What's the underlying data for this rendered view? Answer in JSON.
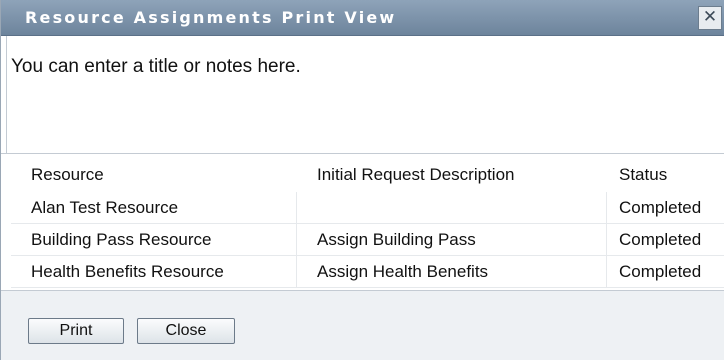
{
  "dialog": {
    "title": "Resource Assignments Print View",
    "close_glyph": "✕",
    "notes_text": "You can enter a title or notes here."
  },
  "table": {
    "columns": [
      "Resource",
      "Initial Request Description",
      "Status"
    ],
    "rows": [
      [
        "Alan Test Resource",
        "",
        "Completed"
      ],
      [
        "Building Pass Resource",
        "Assign Building Pass",
        "Completed"
      ],
      [
        "Health Benefits Resource",
        "Assign Health Benefits",
        "Completed"
      ]
    ]
  },
  "footer": {
    "print_label": "Print",
    "close_label": "Close"
  },
  "colors": {
    "titlebar": "#7d93aa",
    "footer_bg": "#eef1f4"
  }
}
